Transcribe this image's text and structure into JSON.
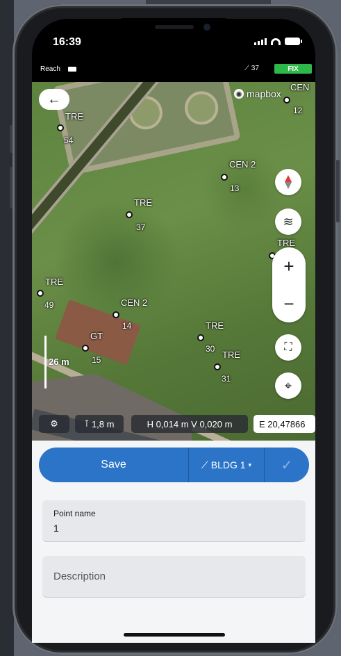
{
  "status": {
    "time": "16:39"
  },
  "receiver": {
    "name": "Reach",
    "satellites": "37",
    "fix": "FIX"
  },
  "map": {
    "attribution": "mapbox",
    "scale": "26 m",
    "points": [
      {
        "code": "TRE",
        "number": "54"
      },
      {
        "code": "TRE",
        "number": "37"
      },
      {
        "code": "TRE",
        "number": "49"
      },
      {
        "code": "CEN 2",
        "number": "13"
      },
      {
        "code": "CEN 2",
        "number": "14"
      },
      {
        "code": "CEN",
        "number": "12"
      },
      {
        "code": "GT",
        "number": "15"
      },
      {
        "code": "TRE",
        "number": "30"
      },
      {
        "code": "TRE",
        "number": "31"
      },
      {
        "code": "TRE",
        "number": ""
      }
    ],
    "info": {
      "antenna_height": "1,8 m",
      "precision": "H 0,014 m  V 0,020 m",
      "easting": "E 20,47866"
    }
  },
  "actions": {
    "save_label": "Save",
    "code_label": "BLDG 1",
    "code_arrow": "▾",
    "confirm": "✓"
  },
  "form": {
    "point_name_label": "Point name",
    "point_name_value": "1",
    "description_placeholder": "Description"
  },
  "colors": {
    "accent": "#2b74c7",
    "fix": "#2fb84a"
  }
}
